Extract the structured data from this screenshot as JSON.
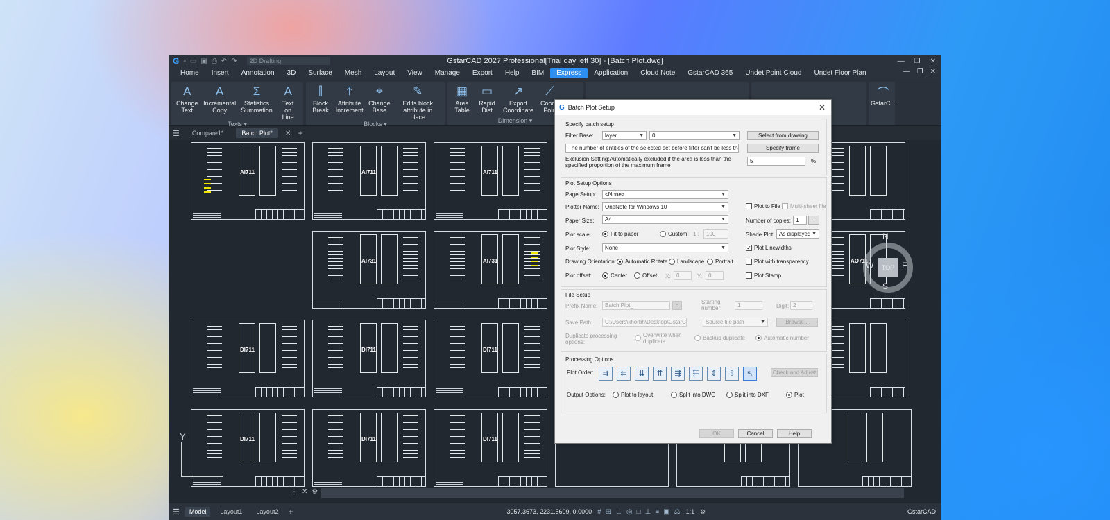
{
  "app": {
    "title": "GstarCAD 2027 Professional[Trial day left 30] - [Batch Plot.dwg]",
    "workspace": "2D Drafting",
    "brand": "GstarCAD"
  },
  "menu": [
    "Home",
    "Insert",
    "Annotation",
    "3D",
    "Surface",
    "Mesh",
    "Layout",
    "View",
    "Manage",
    "Export",
    "Help",
    "BIM",
    "Express",
    "Application",
    "Cloud Note",
    "GstarCAD 365",
    "Undet Point Cloud",
    "Undet Floor Plan"
  ],
  "ribbon": {
    "texts_panel": {
      "title": "Texts ▾",
      "buttons": [
        {
          "icon": "A",
          "label": "Change\nText"
        },
        {
          "icon": "A",
          "label": "Incremental\nCopy"
        },
        {
          "icon": "Σ",
          "label": "Statistics\nSummation"
        },
        {
          "icon": "A",
          "label": "Text\non Line"
        }
      ]
    },
    "blocks_panel": {
      "title": "Blocks ▾",
      "buttons": [
        {
          "icon": "⫿",
          "label": "Block\nBreak"
        },
        {
          "icon": "⤒",
          "label": "Attribute\nIncrement"
        },
        {
          "icon": "⌖",
          "label": "Change\nBase"
        },
        {
          "icon": "✎",
          "label": "Edits block\nattribute in place"
        }
      ]
    },
    "dimension_panel": {
      "title": "Dimension ▾",
      "buttons": [
        {
          "icon": "▦",
          "label": "Area\nTable"
        },
        {
          "icon": "▭",
          "label": "Rapid\nDist"
        },
        {
          "icon": "↗",
          "label": "Export\nCoordinate"
        },
        {
          "icon": "⟋",
          "label": "Coordi\nPoin"
        }
      ]
    },
    "extra_label": "GstarC..."
  },
  "doc_tabs": [
    "Compare1*",
    "Batch Plot*"
  ],
  "sheets": {
    "labels": [
      "AI711",
      "AI711",
      "AI711",
      "AI731",
      "AI731",
      "AO711",
      "DI711",
      "DI711",
      "DI711",
      "DI711",
      "DI711",
      "DI711"
    ]
  },
  "compass": {
    "top": "TOP",
    "n": "N",
    "w": "W",
    "e": "E",
    "s": "S"
  },
  "ucs_label": "Y",
  "status": {
    "layouts": [
      "Model",
      "Layout1",
      "Layout2"
    ],
    "coords": "3057.3673, 2231.5609, 0.0000",
    "scale": "1:1"
  },
  "dialog": {
    "title": "Batch Plot Setup",
    "batch": {
      "group_title": "Specify batch setup",
      "filter_label": "Filter Base:",
      "filter_value": "layer",
      "filter_value2": "0",
      "select_button": "Select from drawing",
      "hint_text": "The number of entities of the selected set before filter can't be less than 1",
      "specify_frame_button": "Specify frame",
      "exclusion_text": "Exclusion Setting:Automatically excluded if the area is less than the specified proportion of the maximum frame",
      "exclusion_value": "5",
      "percent": "%"
    },
    "plot": {
      "group_title": "Plot Setup  Options",
      "page_setup_label": "Page Setup:",
      "page_setup_value": "<None>",
      "plotter_label": "Plotter Name:",
      "plotter_value": "OneNote for Windows 10",
      "paper_label": "Paper Size:",
      "paper_value": "A4",
      "scale_label": "Plot scale:",
      "fit_label": "Fit to paper",
      "custom_label": "Custom:",
      "custom_ratio": "1 :",
      "custom_value": "100",
      "style_label": "Plot Style:",
      "style_value": "None",
      "orient_label": "Drawing Orientation:",
      "auto_rotate": "Automatic Rotate",
      "landscape": "Landscape",
      "portrait": "Portrait",
      "offset_label": "Plot offset:",
      "center": "Center",
      "offset": "Offset",
      "x_label": "X:",
      "x_value": "0",
      "y_label": "Y:",
      "y_value": "0",
      "plot_to_file": "Plot to File",
      "multi_sheet": "Multi-sheet file",
      "copies_label": "Number of copies:",
      "copies_value": "1",
      "shade_label": "Shade Plot:",
      "shade_value": "As displayed",
      "linewidths": "Plot Linewidths",
      "transparency": "Plot with transparency",
      "stamp": "Plot Stamp"
    },
    "file": {
      "group_title": "File Setup",
      "prefix_label": "Prefix Name:",
      "prefix_value": "Batch Plot_",
      "starting_label": "Starting\nnumber:",
      "starting_value": "1",
      "digit_label": "Digit:",
      "digit_value": "2",
      "save_label": "Save Path:",
      "save_value": "C:\\Users\\khorbh\\Desktop\\GstarCAD",
      "source_value": "Source file path",
      "browse": "Browse...",
      "dup_label": "Duplicate processing\noptions:",
      "overwrite": "Overwrite when\nduplicate",
      "backup": "Backup duplicate",
      "auto_number": "Automatic number"
    },
    "processing": {
      "group_title": "Processing Options",
      "order_label": "Plot Order:",
      "check_adjust": "Check and Adjust",
      "output_label": "Output Options:",
      "plot_layout": "Plot to layout",
      "split_dwg": "Split into DWG",
      "split_dxf": "Split into DXF",
      "plot": "Plot"
    },
    "buttons": {
      "ok": "OK",
      "cancel": "Cancel",
      "help": "Help"
    }
  }
}
